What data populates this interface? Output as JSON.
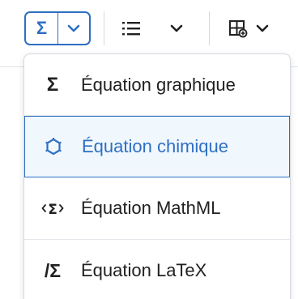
{
  "toolbar": {
    "equation_button_icon": "sigma-icon",
    "equation_button_symbol": "Σ",
    "list_icon": "bulleted-list-icon",
    "table_icon": "table-insert-icon",
    "accent_color": "#2e6fc3"
  },
  "menu": {
    "items": [
      {
        "icon": "sigma-icon",
        "symbol": "Σ",
        "label": "Équation graphique",
        "selected": false
      },
      {
        "icon": "chemistry-icon",
        "symbol": "",
        "label": "Équation chimique",
        "selected": true
      },
      {
        "icon": "mathml-icon",
        "symbol": "",
        "label": "Équation MathML",
        "selected": false
      },
      {
        "icon": "latex-icon",
        "symbol": "/Σ",
        "label": "Équation LaTeX",
        "selected": false
      }
    ]
  }
}
